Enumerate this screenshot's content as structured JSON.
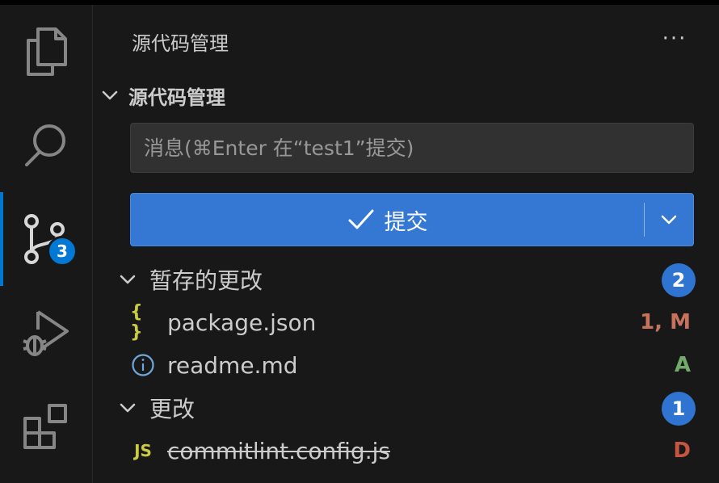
{
  "colors": {
    "accent": "#0078d4",
    "commit_button": "#3478d3",
    "modified": "#c5735c",
    "added": "#73a96b",
    "deleted": "#c5553f",
    "json_icon": "#cbcb41",
    "js_icon": "#cbcb41",
    "info_icon": "#6fa8dc"
  },
  "activity_bar": {
    "items": [
      {
        "name": "explorer",
        "icon": "files-icon"
      },
      {
        "name": "search",
        "icon": "search-icon"
      },
      {
        "name": "source-control",
        "icon": "source-control-icon",
        "badge": "3",
        "active": true
      },
      {
        "name": "run-debug",
        "icon": "run-debug-icon"
      },
      {
        "name": "extensions",
        "icon": "extensions-icon"
      }
    ]
  },
  "sidebar": {
    "title": "源代码管理",
    "more_label": "···",
    "section_title": "源代码管理",
    "message_placeholder": "消息(⌘Enter 在“test1”提交)",
    "message_value": "",
    "commit_label": "提交",
    "groups": [
      {
        "label": "暂存的更改",
        "count": "2",
        "files": [
          {
            "icon_text": "{ }",
            "icon": "json-icon",
            "name": "package.json",
            "status": "1, M",
            "deleted": false
          },
          {
            "icon_text": "ⓘ",
            "icon": "info-icon",
            "name": "readme.md",
            "status": "A",
            "deleted": false
          }
        ]
      },
      {
        "label": "更改",
        "count": "1",
        "files": [
          {
            "icon_text": "JS",
            "icon": "js-icon",
            "name": "commitlint.config.js",
            "status": "D",
            "deleted": true
          }
        ]
      }
    ]
  }
}
